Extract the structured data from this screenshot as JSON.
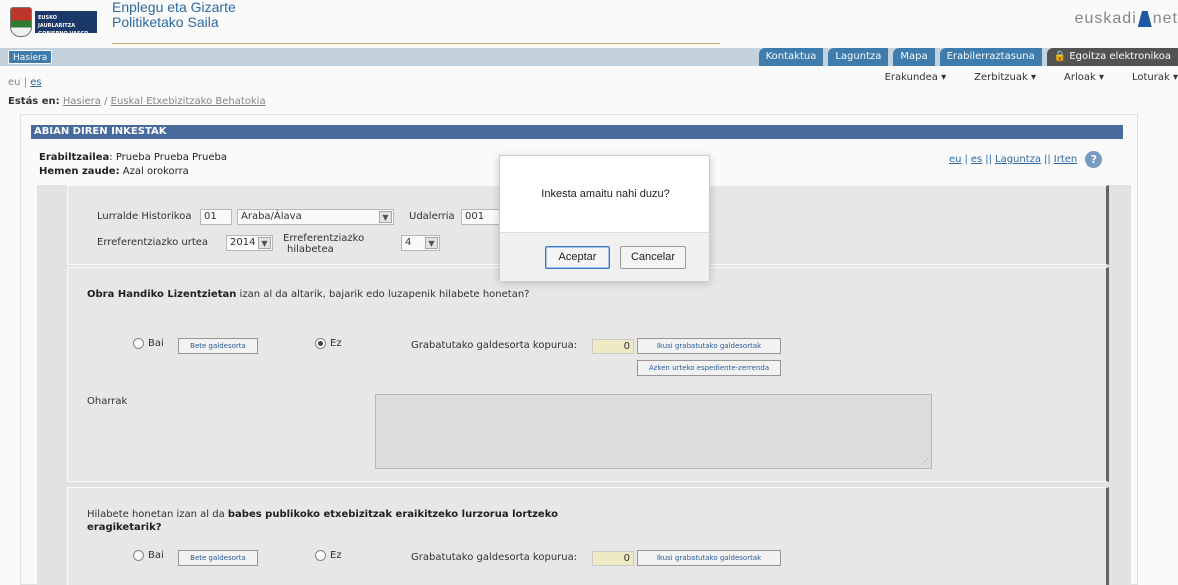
{
  "header": {
    "dept_line1": "Enplegu eta Gizarte",
    "dept_line2": "Politiketako Saila",
    "gov_plate": "EUSKO JAURLARITZA GOBIERNO VASCO",
    "euskadi_logo_left": "euskadi",
    "euskadi_logo_right": "net"
  },
  "navbar": {
    "home": "Hasiera",
    "links": [
      "Kontaktua",
      "Laguntza",
      "Mapa",
      "Erabilerraztasuna",
      "Egoitza elektronikoa"
    ]
  },
  "lang": {
    "eu": "eu",
    "sep": "|",
    "es": "es"
  },
  "menu": [
    "Erakundea ▾",
    "Zerbitzuak ▾",
    "Arloak ▾",
    "Loturak ▾"
  ],
  "breadcrumb": {
    "label": "Estás en:",
    "home": "Hasiera",
    "sep": "/",
    "current": "Euskal Etxebizitzako Behatokia"
  },
  "panel": {
    "title": "ABIAN DIREN INKESTAK",
    "user_label": "Erabiltzailea",
    "user_value": ": Prueba Prueba Prueba",
    "location_label": "Hemen zaude:",
    "location_value": " Azal orokorra",
    "links": {
      "eu": "eu",
      "es": "es",
      "help": "Laguntza",
      "exit": "Irten",
      "sep1": "|",
      "sep2": "||",
      "sep3": "||"
    }
  },
  "filters": {
    "territory_label": "Lurralde Historikoa",
    "territory_code": "01",
    "territory_name": "Araba/Álava",
    "municipality_label": "Udalerria",
    "municipality_code": "001",
    "year_label": "Erreferentziazko urtea",
    "year_value": "2014",
    "month_label_1": "Erreferentziazko",
    "month_label_2": "hilabetea",
    "month_value": "4"
  },
  "q1": {
    "bold": "Obra Handiko Lizentzietan",
    "rest": " izan al da altarik, bajarik edo luzapenik hilabete honetan?",
    "yes": "Bai",
    "no": "Ez",
    "fill_button": "Bete galdesorta",
    "count_label": "Grabatutako galdesorta kopurua:",
    "count_value": "0",
    "view_button": "Ikusi grabatutako galdesortak",
    "last_year_button": "Azken urteko espediente-zerrenda",
    "notes_label": "Oharrak"
  },
  "q2": {
    "pre": "Hilabete honetan izan al da ",
    "bold": "babes publikoko etxebizitzak eraikitzeko lurzorua lortzeko eragiketarik?",
    "yes": "Bai",
    "no": "Ez",
    "fill_button": "Bete galdesorta",
    "count_label": "Grabatutako galdesorta kopurua:",
    "count_value": "0",
    "view_button": "Ikusi grabatutako galdesortak"
  },
  "dialog": {
    "message": "Inkesta amaitu nahi duzu?",
    "accept": "Aceptar",
    "cancel": "Cancelar"
  }
}
